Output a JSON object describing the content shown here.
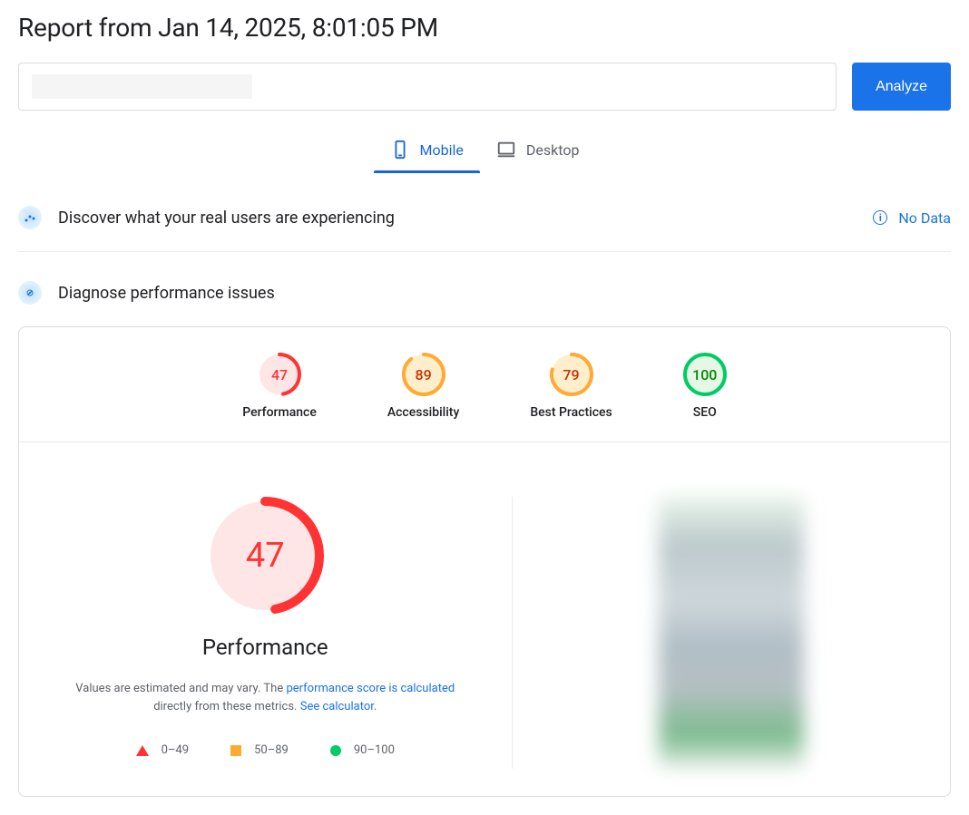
{
  "page_title": "Report from Jan 14, 2025, 8:01:05 PM",
  "analyze_button": "Analyze",
  "tabs": {
    "mobile": "Mobile",
    "desktop": "Desktop"
  },
  "discover": {
    "title": "Discover what your real users are experiencing",
    "no_data": "No Data"
  },
  "diagnose": {
    "title": "Diagnose performance issues"
  },
  "gauges": [
    {
      "label": "Performance",
      "score": "47",
      "status": "red"
    },
    {
      "label": "Accessibility",
      "score": "89",
      "status": "orange"
    },
    {
      "label": "Best Practices",
      "score": "79",
      "status": "orange"
    },
    {
      "label": "SEO",
      "score": "100",
      "status": "green"
    }
  ],
  "performance_detail": {
    "score": "47",
    "heading": "Performance",
    "desc_prefix": "Values are estimated and may vary. The ",
    "desc_link1": "performance score is calculated",
    "desc_mid": " directly from these metrics. ",
    "desc_link2": "See calculator",
    "desc_suffix": "."
  },
  "legend": {
    "r1": "0–49",
    "r2": "50–89",
    "r3": "90–100"
  },
  "colors": {
    "red": "#ff3333",
    "orange": "#ffaa33",
    "green": "#00cc66"
  }
}
